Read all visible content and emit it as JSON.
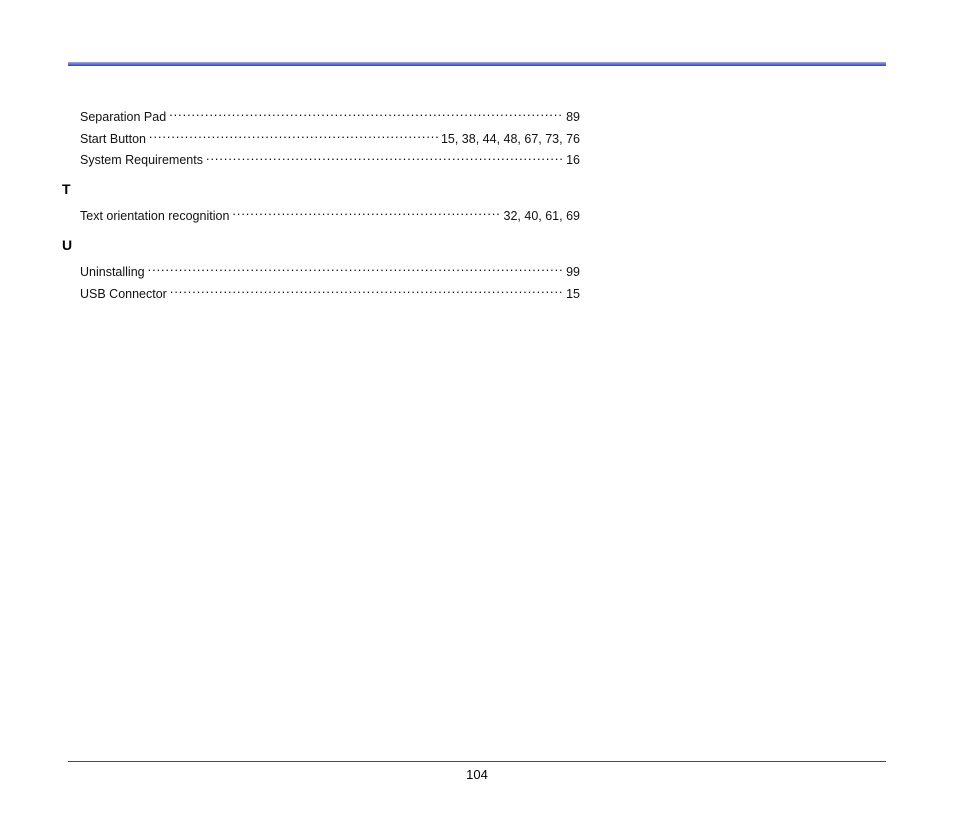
{
  "colors": {
    "rule_blue": "#2b3fd8"
  },
  "page_number": "104",
  "sections": {
    "pre": [
      {
        "label": "Separation Pad",
        "pages": [
          "89"
        ]
      },
      {
        "label": "Start Button",
        "pages": [
          "15",
          "38",
          "44",
          "48",
          "67",
          "73",
          "76"
        ]
      },
      {
        "label": "System Requirements",
        "pages": [
          "16"
        ]
      }
    ],
    "T": {
      "letter": "T",
      "items": [
        {
          "label": "Text orientation recognition",
          "pages": [
            "32",
            "40",
            "61",
            "69"
          ]
        }
      ]
    },
    "U": {
      "letter": "U",
      "items": [
        {
          "label": "Uninstalling",
          "pages": [
            "99"
          ]
        },
        {
          "label": "USB Connector",
          "pages": [
            "15"
          ]
        }
      ]
    }
  }
}
